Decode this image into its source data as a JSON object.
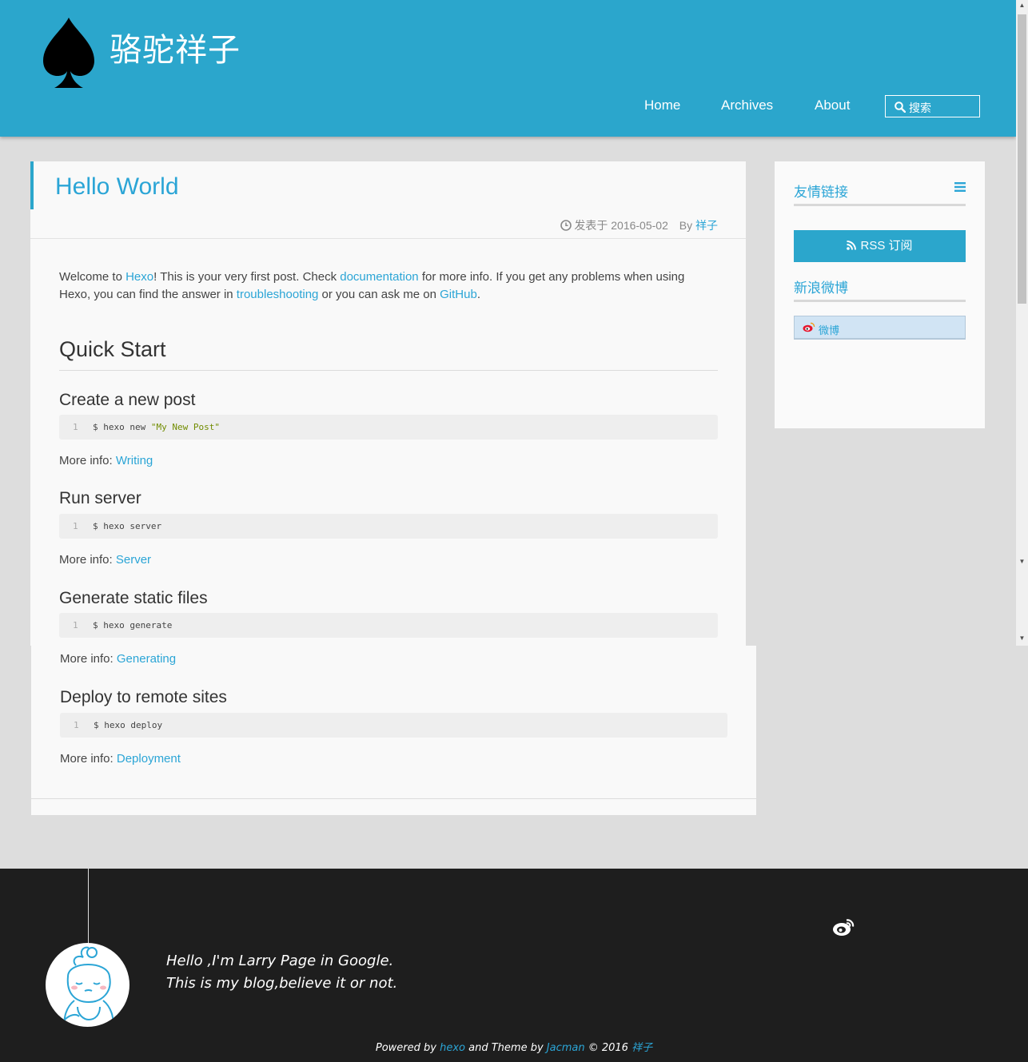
{
  "header": {
    "site_title": "骆驼祥子",
    "nav": [
      {
        "label": "Home"
      },
      {
        "label": "Archives"
      },
      {
        "label": "About"
      }
    ],
    "search_placeholder": "搜索"
  },
  "post": {
    "title": "Hello World",
    "meta": {
      "prefix": "发表于",
      "date": "2016-05-02",
      "by": "By",
      "author": "祥子"
    },
    "intro": {
      "t1": "Welcome to ",
      "l1": "Hexo",
      "t2": "! This is your very first post. Check ",
      "l2": "documentation",
      "t3": " for more info. If you get any problems when using Hexo, you can find the answer in ",
      "l3": "troubleshooting",
      "t4": " or you can ask me on ",
      "l4": "GitHub",
      "t5": "."
    },
    "section_title": "Quick Start",
    "more_info_prefix": "More info: ",
    "steps": [
      {
        "heading": "Create a new post",
        "line": "1",
        "cmd": "$ hexo new ",
        "str": "\"My New Post\"",
        "link": "Writing"
      },
      {
        "heading": "Run server",
        "line": "1",
        "cmd": "$ hexo server",
        "str": "",
        "link": "Server"
      },
      {
        "heading": "Generate static files",
        "line": "1",
        "cmd": "$ hexo generate",
        "str": "",
        "link": "Generating"
      },
      {
        "heading": "Deploy to remote sites",
        "line": "1",
        "cmd": "$ hexo deploy",
        "str": "",
        "link": "Deployment"
      }
    ]
  },
  "sidebar": {
    "links_title": "友情链接",
    "rss_label": "RSS 订阅",
    "weibo_title": "新浪微博",
    "weibo_button": "微博"
  },
  "footer": {
    "bio_line1": "Hello ,I'm Larry Page in Google.",
    "bio_line2": "This is my blog,believe it or not.",
    "powered_by": "Powered by ",
    "hexo": "hexo",
    "and_theme_by": " and Theme by ",
    "jacman": "Jacman",
    "year": " © 2016 ",
    "author": "祥子"
  },
  "colors": {
    "accent": "#2ba6cc",
    "link": "#2ba5d6",
    "footer_bg": "#1e1e1e",
    "page_bg": "#dddddd"
  }
}
